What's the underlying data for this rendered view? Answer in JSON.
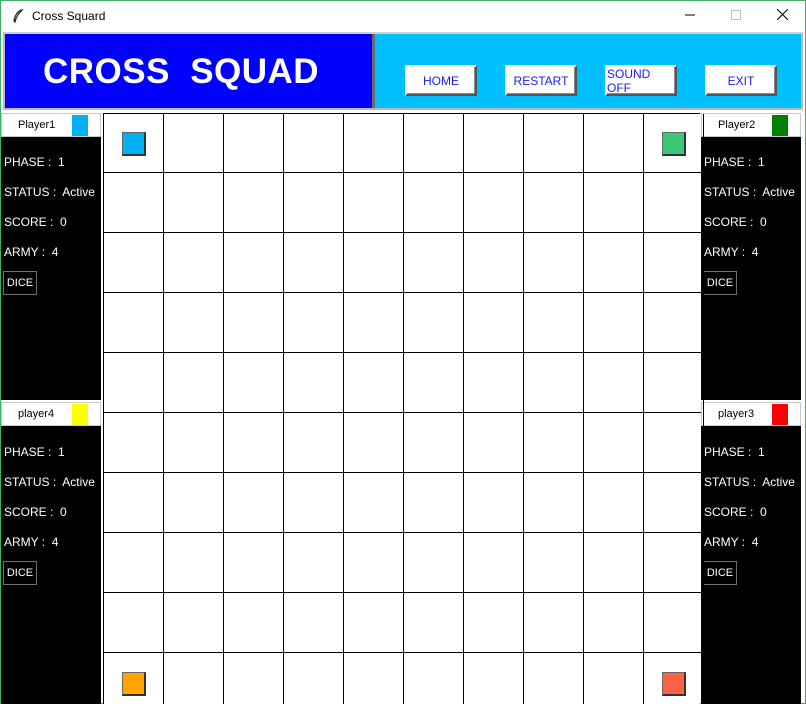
{
  "window": {
    "title": "Cross Squard"
  },
  "header": {
    "title": "CROSS  SQUAD",
    "buttons": {
      "home": "HOME",
      "restart": "RESTART",
      "sound": "SOUND OFF",
      "exit": "EXIT"
    }
  },
  "players": {
    "p1": {
      "name": "Player1",
      "color": "#00b0f0",
      "phase_label": "PHASE :  1",
      "status_label": "STATUS :  Active",
      "score_label": "SCORE :  0",
      "army_label": "ARMY :  4",
      "dice": "DICE"
    },
    "p2": {
      "name": "Player2",
      "color": "#008000",
      "phase_label": "PHASE :  1",
      "status_label": "STATUS :  Active",
      "score_label": "SCORE :  0",
      "army_label": "ARMY :  4",
      "dice": "DICE"
    },
    "p3": {
      "name": "player3",
      "color": "#ff0000",
      "phase_label": "PHASE :  1",
      "status_label": "STATUS :  Active",
      "score_label": "SCORE :  0",
      "army_label": "ARMY :  4",
      "dice": "DICE"
    },
    "p4": {
      "name": "player4",
      "color": "#ffff00",
      "phase_label": "PHASE :  1",
      "status_label": "STATUS :  Active",
      "score_label": "SCORE :  0",
      "army_label": "ARMY :  4",
      "dice": "DICE"
    }
  },
  "board": {
    "columns": 10,
    "rows_visible": 10,
    "pieces": [
      {
        "player": "Player1",
        "color": "#00b0f0",
        "col": 0,
        "row": 0
      },
      {
        "player": "Player2",
        "color": "#3cc878",
        "col": 9,
        "row": 0
      },
      {
        "player": "player4",
        "color": "#ffa500",
        "col": 0,
        "row": 9
      },
      {
        "player": "player3",
        "color": "#ff6347",
        "col": 9,
        "row": 9
      }
    ]
  },
  "icons": {
    "app": "feather-icon",
    "minimize": "minimize-icon",
    "maximize": "maximize-icon",
    "close": "close-icon"
  }
}
